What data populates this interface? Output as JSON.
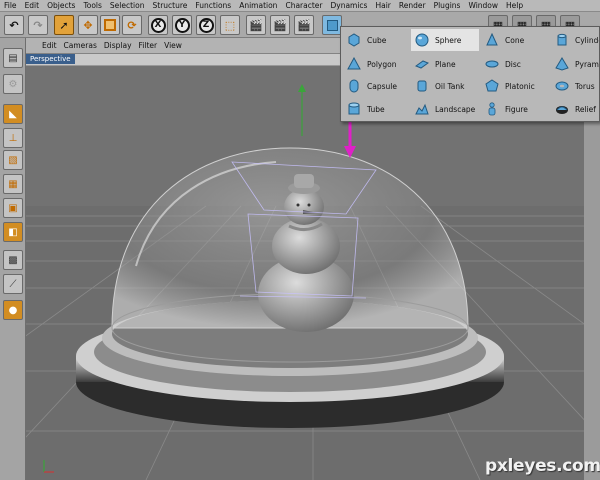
{
  "menu": [
    "File",
    "Edit",
    "Objects",
    "Tools",
    "Selection",
    "Structure",
    "Functions",
    "Animation",
    "Character",
    "Dynamics",
    "Hair",
    "Render",
    "Plugins",
    "Window",
    "Help"
  ],
  "toolbar": {
    "x_label": "X",
    "y_label": "Y",
    "z_label": "Z"
  },
  "viewport": {
    "menu": [
      "Edit",
      "Cameras",
      "Display",
      "Filter",
      "View"
    ],
    "title": "Perspective"
  },
  "primitives_popup": {
    "items": [
      {
        "label": "Cube",
        "icon": "cube-icon"
      },
      {
        "label": "Sphere",
        "icon": "sphere-icon",
        "highlighted": true
      },
      {
        "label": "Cone",
        "icon": "cone-icon"
      },
      {
        "label": "Cylinder",
        "icon": "cylinder-icon"
      },
      {
        "label": "Polygon",
        "icon": "polygon-icon"
      },
      {
        "label": "Plane",
        "icon": "plane-icon"
      },
      {
        "label": "Disc",
        "icon": "disc-icon"
      },
      {
        "label": "Pyramid",
        "icon": "pyramid-icon"
      },
      {
        "label": "Capsule",
        "icon": "capsule-icon"
      },
      {
        "label": "Oil Tank",
        "icon": "oil-tank-icon"
      },
      {
        "label": "Platonic",
        "icon": "platonic-icon"
      },
      {
        "label": "Torus",
        "icon": "torus-icon"
      },
      {
        "label": "Tube",
        "icon": "tube-icon"
      },
      {
        "label": "Landscape",
        "icon": "landscape-icon"
      },
      {
        "label": "Figure",
        "icon": "figure-icon"
      },
      {
        "label": "Relief",
        "icon": "relief-icon"
      }
    ]
  },
  "watermark": "pxleyes.com",
  "colors": {
    "arrow": "#e020c8",
    "accent_orange": "#d49a2a",
    "icon_blue": "#5aa6d8",
    "viewport_title_bg": "#3a5f8c"
  }
}
